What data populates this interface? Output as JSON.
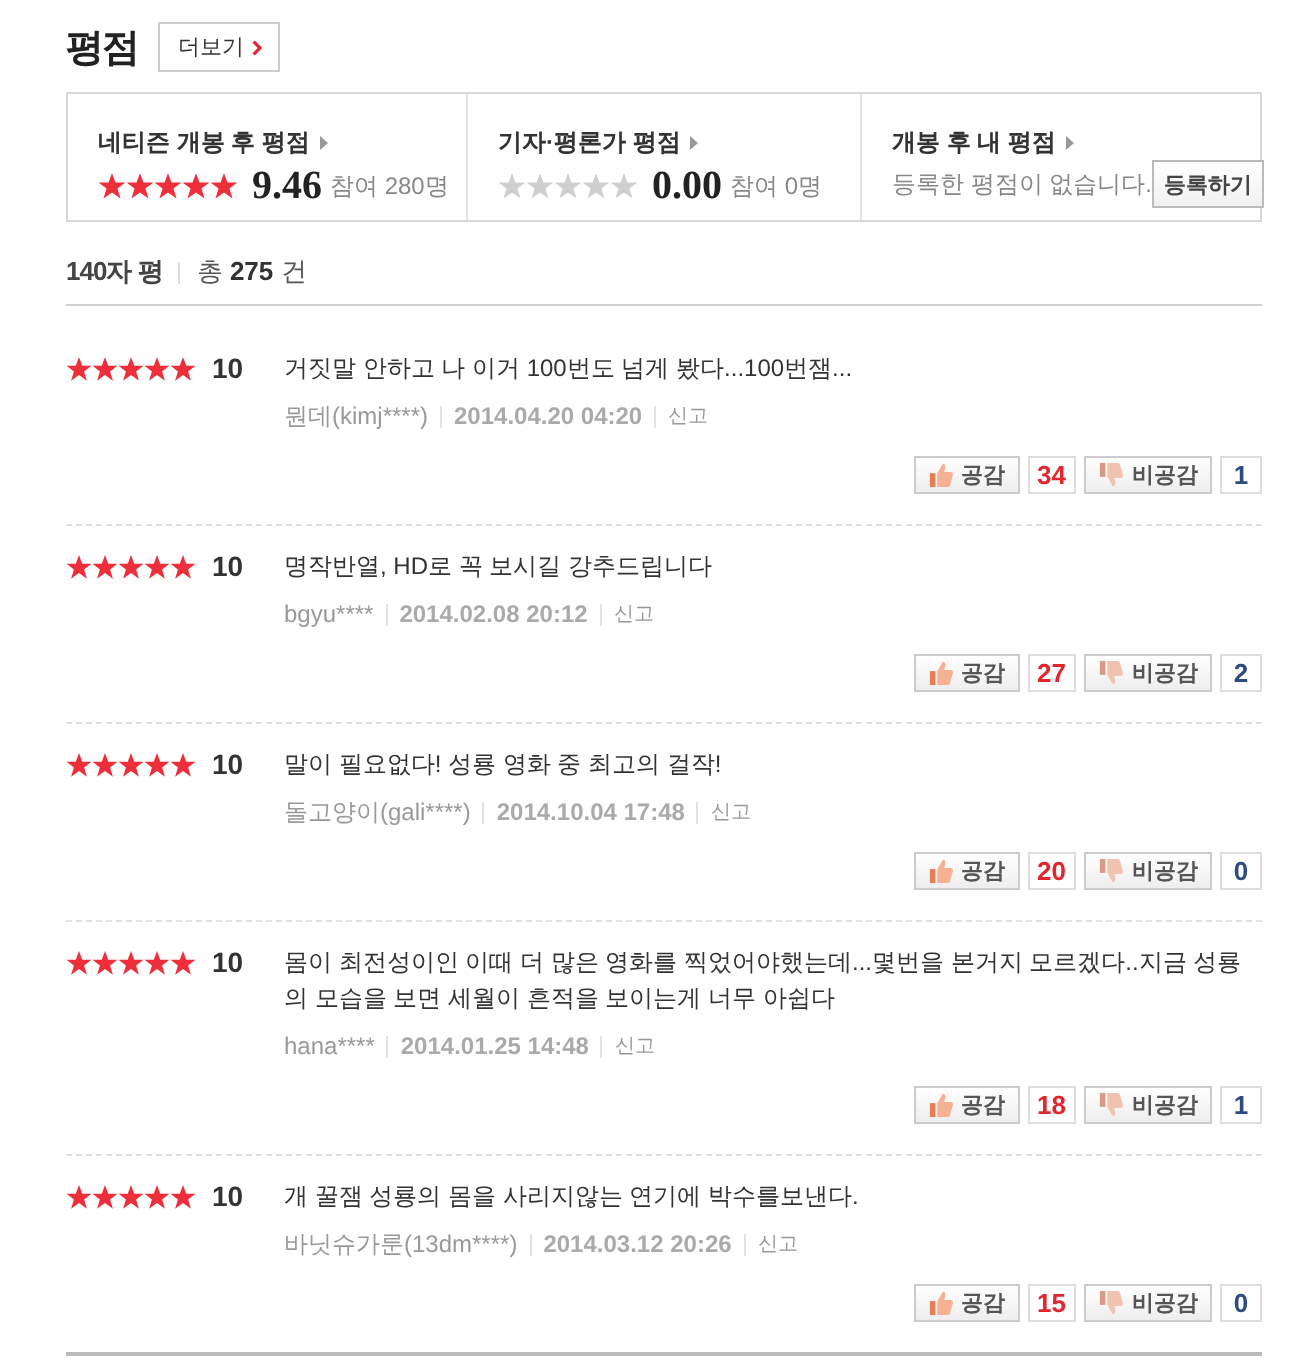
{
  "header": {
    "title": "평점",
    "more_button": "더보기"
  },
  "summary": [
    {
      "kind": "rating",
      "label": "네티즌 개봉 후 평점",
      "stars": 5,
      "score": "9.46",
      "participants": "참여 280명"
    },
    {
      "kind": "rating",
      "label": "기자·평론가 평점",
      "stars": 0,
      "score": "0.00",
      "participants": "참여 0명"
    },
    {
      "kind": "mine",
      "label": "개봉 후 내 평점",
      "message": "등록한 평점이 없습니다.",
      "button": "등록하기"
    }
  ],
  "list_header": {
    "title": "140자 평",
    "total": "총 **275** 건"
  },
  "reviews": [
    {
      "stars": 5,
      "score": "10",
      "text": "거짓말 안하고 나 이거 100번도 넘게 봤다...100번잼...",
      "author": "뭔데(kimj****)",
      "date": "2014.04.20 04:20",
      "report": "신고",
      "like_label": "공감",
      "likes": "34",
      "dislike_label": "비공감",
      "dislikes": "1"
    },
    {
      "stars": 5,
      "score": "10",
      "text": "명작반열, HD로 꼭 보시길 강추드립니다",
      "author": "bgyu****",
      "date": "2014.02.08 20:12",
      "report": "신고",
      "like_label": "공감",
      "likes": "27",
      "dislike_label": "비공감",
      "dislikes": "2"
    },
    {
      "stars": 5,
      "score": "10",
      "text": "말이 필요없다! 성룡 영화 중 최고의 걸작!",
      "author": "돌고양이(gali****)",
      "date": "2014.10.04 17:48",
      "report": "신고",
      "like_label": "공감",
      "likes": "20",
      "dislike_label": "비공감",
      "dislikes": "0"
    },
    {
      "stars": 5,
      "score": "10",
      "text": "몸이 최전성이인 이때 더 많은 영화를 찍었어야했는데...몇번을 본거지 모르겠다..지금 성룡의 모습을 보면 세월이 흔적을 보이는게 너무 아쉽다",
      "author": "hana****",
      "date": "2014.01.25 14:48",
      "report": "신고",
      "like_label": "공감",
      "likes": "18",
      "dislike_label": "비공감",
      "dislikes": "1"
    },
    {
      "stars": 5,
      "score": "10",
      "text": "개 꿀잼 성룡의 몸을 사리지않는 연기에 박수를보낸다.",
      "author": "바닛슈가룬(13dm****)",
      "date": "2014.03.12 20:26",
      "report": "신고",
      "like_label": "공감",
      "likes": "15",
      "dislike_label": "비공감",
      "dislikes": "0"
    }
  ]
}
